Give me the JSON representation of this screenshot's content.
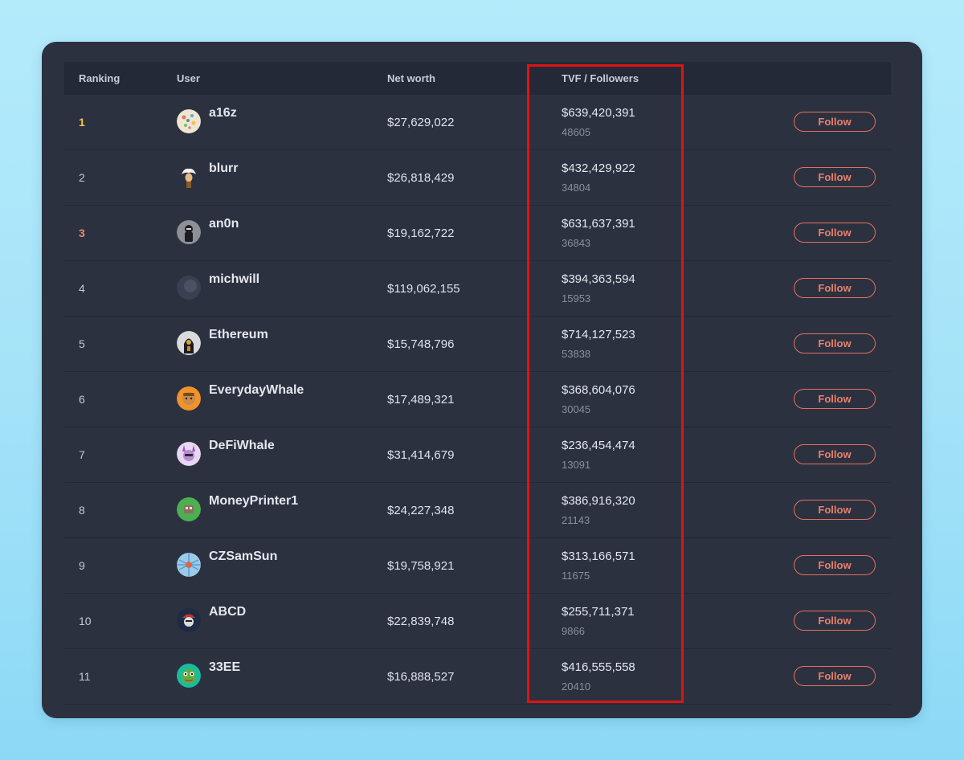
{
  "table": {
    "headers": {
      "ranking": "Ranking",
      "user": "User",
      "net_worth": "Net worth",
      "tvf_followers": "TVF / Followers"
    },
    "follow_label": "Follow",
    "rows": [
      {
        "rank": "1",
        "user": "a16z",
        "net_worth": "$27,629,022",
        "tvf": "$639,420,391",
        "followers": "48605"
      },
      {
        "rank": "2",
        "user": "blurr",
        "net_worth": "$26,818,429",
        "tvf": "$432,429,922",
        "followers": "34804"
      },
      {
        "rank": "3",
        "user": "an0n",
        "net_worth": "$19,162,722",
        "tvf": "$631,637,391",
        "followers": "36843"
      },
      {
        "rank": "4",
        "user": "michwill",
        "net_worth": "$119,062,155",
        "tvf": "$394,363,594",
        "followers": "15953"
      },
      {
        "rank": "5",
        "user": "Ethereum",
        "net_worth": "$15,748,796",
        "tvf": "$714,127,523",
        "followers": "53838"
      },
      {
        "rank": "6",
        "user": "EverydayWhale",
        "net_worth": "$17,489,321",
        "tvf": "$368,604,076",
        "followers": "30045"
      },
      {
        "rank": "7",
        "user": "DeFiWhale",
        "net_worth": "$31,414,679",
        "tvf": "$236,454,474",
        "followers": "13091"
      },
      {
        "rank": "8",
        "user": "MoneyPrinter1",
        "net_worth": "$24,227,348",
        "tvf": "$386,916,320",
        "followers": "21143"
      },
      {
        "rank": "9",
        "user": "CZSamSun",
        "net_worth": "$19,758,921",
        "tvf": "$313,166,571",
        "followers": "11675"
      },
      {
        "rank": "10",
        "user": "ABCD",
        "net_worth": "$22,839,748",
        "tvf": "$255,711,371",
        "followers": "9866"
      },
      {
        "rank": "11",
        "user": "33EE",
        "net_worth": "$16,888,527",
        "tvf": "$416,555,558",
        "followers": "20410"
      }
    ]
  },
  "colors": {
    "rank_1": "#f5c24a",
    "rank_3": "#f08b6c",
    "follow_accent": "#e4705c",
    "highlight_box": "#e01313"
  }
}
